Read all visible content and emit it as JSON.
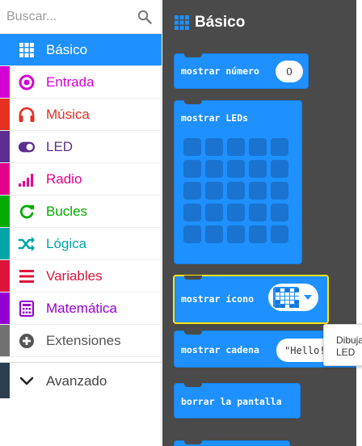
{
  "search": {
    "placeholder": "Buscar..."
  },
  "categories": [
    {
      "label": "Básico",
      "color": "#1e90ff",
      "icon": "grid-icon"
    },
    {
      "label": "Entrada",
      "color": "#d400d4",
      "icon": "radio-button-icon"
    },
    {
      "label": "Música",
      "color": "#e63022",
      "icon": "headphones-icon"
    },
    {
      "label": "LED",
      "color": "#5c2d91",
      "icon": "toggle-icon"
    },
    {
      "label": "Radio",
      "color": "#e3008c",
      "icon": "signal-bars-icon"
    },
    {
      "label": "Bucles",
      "color": "#00aa00",
      "icon": "refresh-icon"
    },
    {
      "label": "Lógica",
      "color": "#00a4a6",
      "icon": "shuffle-icon"
    },
    {
      "label": "Variables",
      "color": "#dc143c",
      "icon": "lines-icon"
    },
    {
      "label": "Matemática",
      "color": "#9400d3",
      "icon": "calculator-icon"
    },
    {
      "label": "Extensiones",
      "color": "#717171",
      "icon": "plus-circle-icon"
    }
  ],
  "advanced": {
    "label": "Avanzado",
    "color": "#2c3e50",
    "icon": "chevron-down-icon"
  },
  "flyout": {
    "title": "Básico",
    "blocks": {
      "show_number": {
        "label": "mostrar número",
        "value": "0"
      },
      "show_leds": {
        "label": "mostrar LEDs"
      },
      "show_icon": {
        "label": "mostrar ícono"
      },
      "show_string": {
        "label": "mostrar cadena",
        "value": "\"Hello!"
      },
      "clear_screen": {
        "label": "borrar la pantalla"
      }
    }
  },
  "tooltip": {
    "line1": "Dibuja",
    "line2": "LED"
  },
  "colors": {
    "flyout_bg": "#4a4a4a",
    "block": "#1e90ff",
    "selected_border": "#ffe600"
  }
}
